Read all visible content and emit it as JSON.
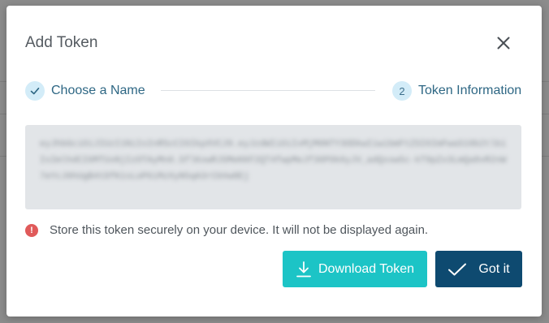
{
  "dialog": {
    "title": "Add Token",
    "close_icon": "close-icon"
  },
  "stepper": {
    "steps": [
      {
        "marker": "✓",
        "label": "Choose a Name",
        "state": "completed"
      },
      {
        "marker": "2",
        "label": "Token Information",
        "state": "active"
      }
    ]
  },
  "token": {
    "value": "eyJhbGciOiJIUzI1NiIsInR5cCI6IkpXVCJ9.eyJzdWIiOiIxMjM0NTY3ODkwIiwibmFtZSI6ImFwaS10b2tlbiIsImlhdCI6MTUxNjIzOTAyMn0.SflKxwRJSMeKKF2QT4fwpMeJf36POk6yJV_adQssw5c-kT9pZx3LmQa8vR2nW7eYcJ0hUgB4tDfK1sLoP6iMzXyN5qA3rCbVw8Ej",
    "obscured": true
  },
  "warning": {
    "icon": "alert-icon",
    "text": "Store this token securely on your device. It will not be displayed again."
  },
  "buttons": {
    "download": {
      "label": "Download Token",
      "icon": "download-icon"
    },
    "got_it": {
      "label": "Got it",
      "icon": "checkmark-icon"
    }
  },
  "colors": {
    "accent_teal": "#1cc4c6",
    "primary_navy": "#0e4a70",
    "step_circle": "#d3ecf8",
    "step_text": "#2e6784",
    "warning_red": "#e05a5a",
    "token_bg": "#e2e5e8"
  }
}
